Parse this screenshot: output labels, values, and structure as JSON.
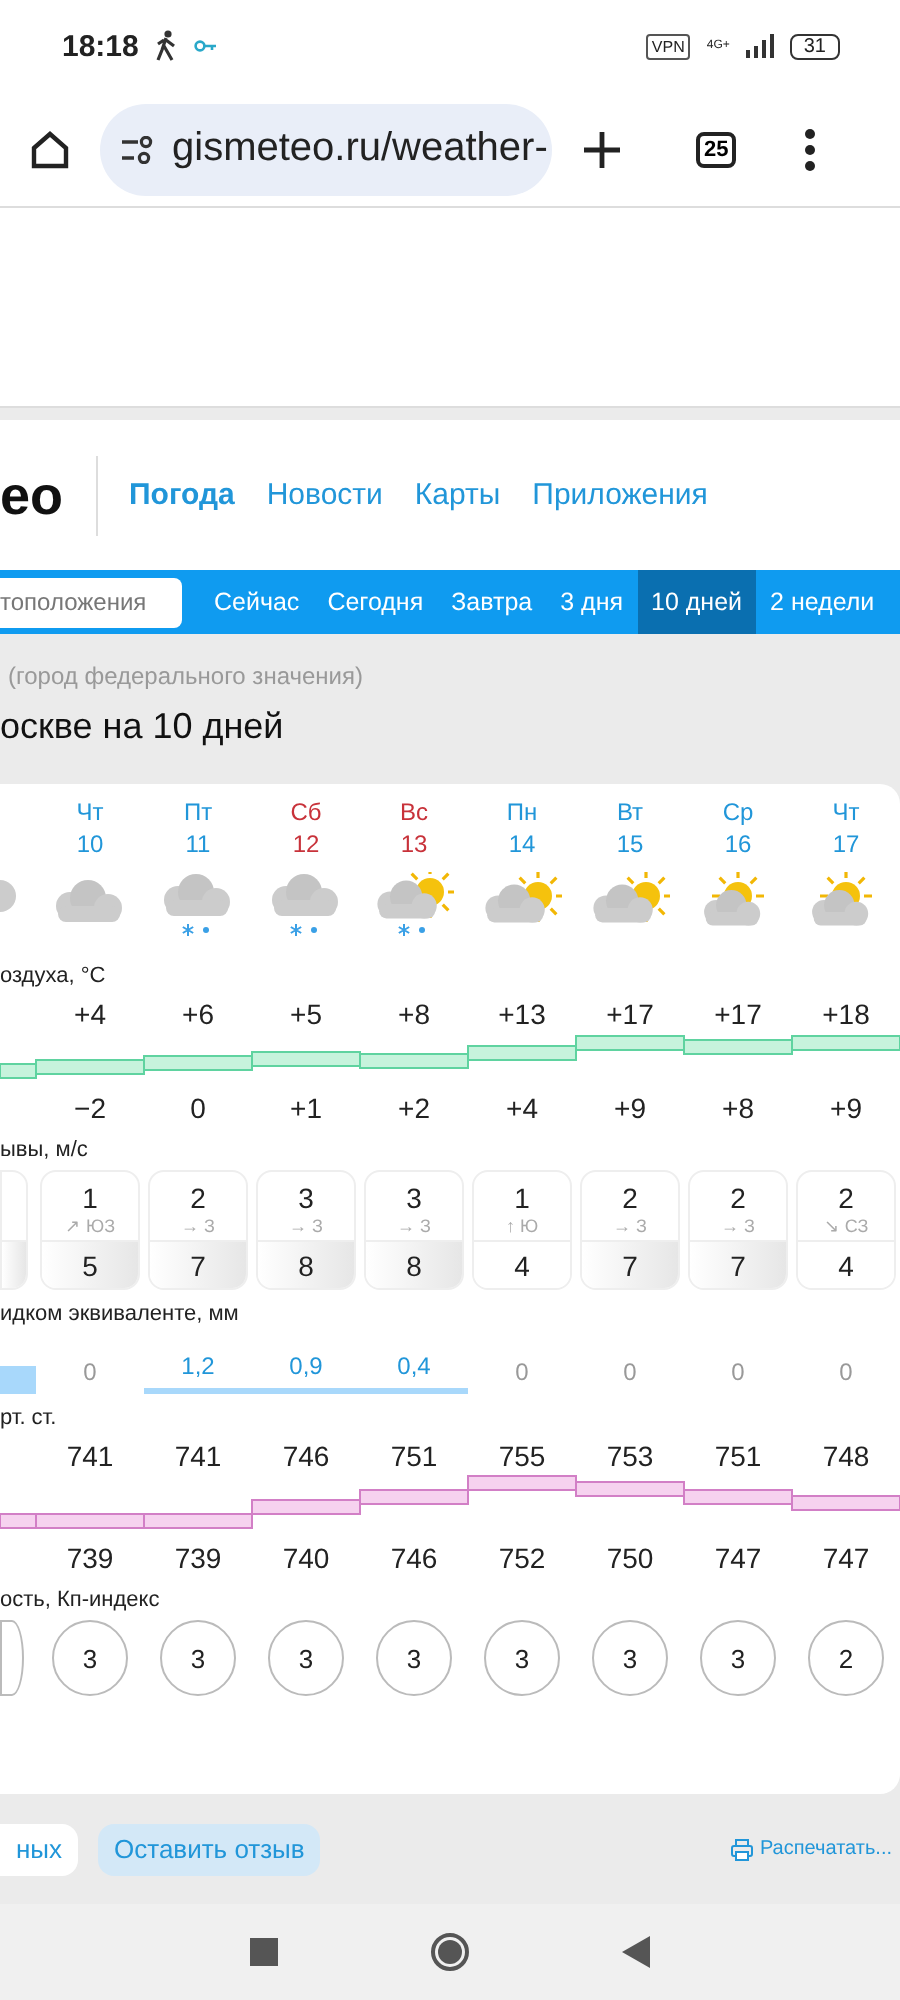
{
  "status_bar": {
    "time": "18:18",
    "vpn": "VPN",
    "network": "4G+",
    "battery": "31"
  },
  "browser": {
    "url": "gismeteo.ru/weather-",
    "tabs_count": "25"
  },
  "site_header": {
    "logo": "eo",
    "nav": [
      {
        "label": "Погода",
        "selected": true
      },
      {
        "label": "Новости",
        "selected": false
      },
      {
        "label": "Карты",
        "selected": false
      },
      {
        "label": "Приложения",
        "selected": false
      }
    ]
  },
  "subnav": {
    "search_placeholder": "тоположения",
    "tabs": [
      {
        "label": "Сейчас",
        "selected": false
      },
      {
        "label": "Сегодня",
        "selected": false
      },
      {
        "label": "Завтра",
        "selected": false
      },
      {
        "label": "3 дня",
        "selected": false
      },
      {
        "label": "10 дней",
        "selected": true
      },
      {
        "label": "2 недели",
        "selected": false
      }
    ]
  },
  "location_note": "(город федерального значения)",
  "page_title": "оскве на 10 дней",
  "days": [
    {
      "weekday": "Чт",
      "date": "10",
      "weekend": false,
      "kind": "cloud",
      "t_max": "+4",
      "t_min": "−2",
      "wind": "1",
      "wind_dir": "↗ ЮЗ",
      "gust": "5",
      "gusty": true,
      "precip": "0",
      "wet": false,
      "p_max": "741",
      "p_min": "739",
      "kp": "3"
    },
    {
      "weekday": "Пт",
      "date": "11",
      "weekend": false,
      "kind": "cloud-snow",
      "t_max": "+6",
      "t_min": "0",
      "wind": "2",
      "wind_dir": "→ З",
      "gust": "7",
      "gusty": true,
      "precip": "1,2",
      "wet": true,
      "p_max": "741",
      "p_min": "739",
      "kp": "3"
    },
    {
      "weekday": "Сб",
      "date": "12",
      "weekend": true,
      "kind": "cloud-snow",
      "t_max": "+5",
      "t_min": "+1",
      "wind": "3",
      "wind_dir": "→ З",
      "gust": "8",
      "gusty": true,
      "precip": "0,9",
      "wet": true,
      "p_max": "746",
      "p_min": "740",
      "kp": "3"
    },
    {
      "weekday": "Вс",
      "date": "13",
      "weekend": true,
      "kind": "sun-cloud-snow",
      "t_max": "+8",
      "t_min": "+2",
      "wind": "3",
      "wind_dir": "→ З",
      "gust": "8",
      "gusty": true,
      "precip": "0,4",
      "wet": true,
      "p_max": "751",
      "p_min": "746",
      "kp": "3"
    },
    {
      "weekday": "Пн",
      "date": "14",
      "weekend": false,
      "kind": "sun-cloud",
      "t_max": "+13",
      "t_min": "+4",
      "wind": "1",
      "wind_dir": "↑ Ю",
      "gust": "4",
      "gusty": false,
      "precip": "0",
      "wet": false,
      "p_max": "755",
      "p_min": "752",
      "kp": "3"
    },
    {
      "weekday": "Вт",
      "date": "15",
      "weekend": false,
      "kind": "sun-cloud",
      "t_max": "+17",
      "t_min": "+9",
      "wind": "2",
      "wind_dir": "→ З",
      "gust": "7",
      "gusty": true,
      "precip": "0",
      "wet": false,
      "p_max": "753",
      "p_min": "750",
      "kp": "3"
    },
    {
      "weekday": "Ср",
      "date": "16",
      "weekend": false,
      "kind": "sun-over-cloud",
      "t_max": "+17",
      "t_min": "+8",
      "wind": "2",
      "wind_dir": "→ З",
      "gust": "7",
      "gusty": true,
      "precip": "0",
      "wet": false,
      "p_max": "751",
      "p_min": "747",
      "kp": "3"
    },
    {
      "weekday": "Чт",
      "date": "17",
      "weekend": false,
      "kind": "sun-over-cloud",
      "t_max": "+18",
      "t_min": "+9",
      "wind": "2",
      "wind_dir": "↘ СЗ",
      "gust": "4",
      "gusty": false,
      "precip": "0",
      "wet": false,
      "p_max": "748",
      "p_min": "747",
      "kp": "2"
    }
  ],
  "section_labels": {
    "temperature": "оздуха, °C",
    "wind": "ывы, м/с",
    "precipitation": "идком эквиваленте, мм",
    "pressure": "рт. ст.",
    "geomagnetic": "ость, Кп-индекс"
  },
  "footer": {
    "buttons": [
      {
        "label": "ных",
        "kind": "plain"
      },
      {
        "label": "Оставить отзыв",
        "kind": "accent"
      }
    ],
    "print_link": "Распечатать..."
  }
}
